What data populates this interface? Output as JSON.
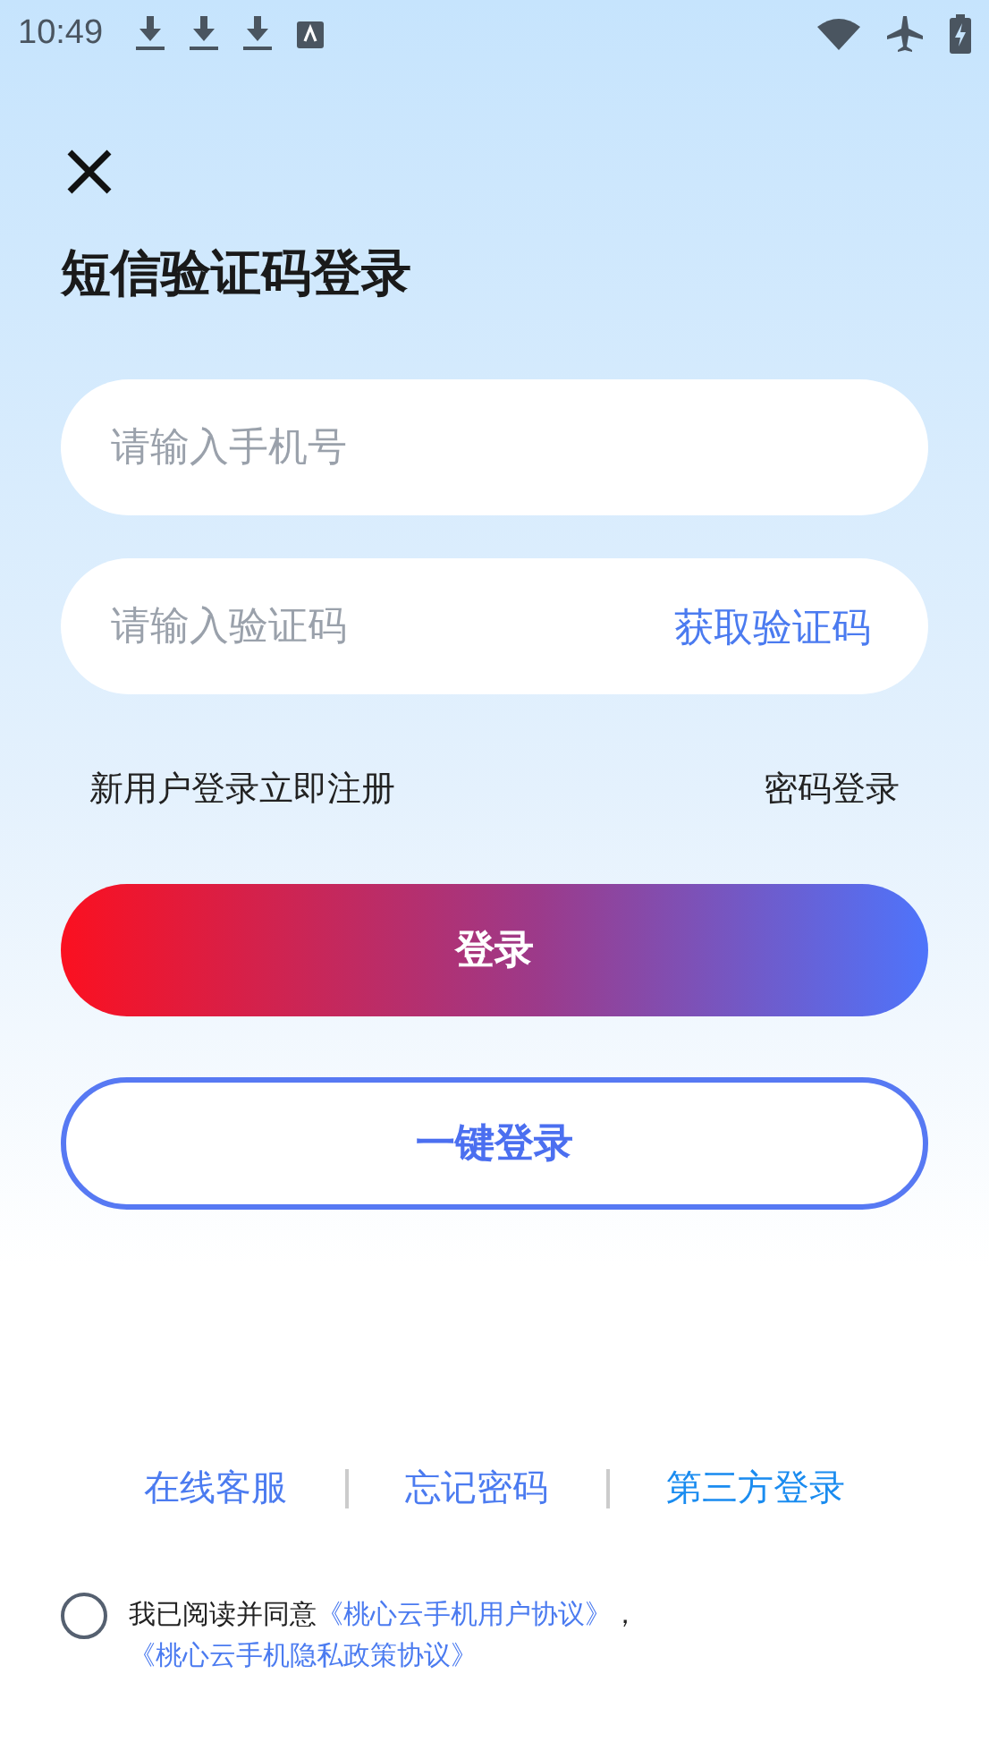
{
  "status_bar": {
    "time": "10:49"
  },
  "title": "短信验证码登录",
  "phone_field": {
    "placeholder": "请输入手机号"
  },
  "code_field": {
    "placeholder": "请输入验证码",
    "action": "获取验证码"
  },
  "links": {
    "register": "新用户登录立即注册",
    "password_login": "密码登录"
  },
  "login_button": "登录",
  "one_click_button": "一键登录",
  "footer_links": [
    {
      "label": "在线客服",
      "color": "#4b7bf0"
    },
    {
      "label": "忘记密码",
      "color": "#4b7bf0"
    },
    {
      "label": "第三方登录",
      "color": "#1a8cf0"
    }
  ],
  "agreement": {
    "checked": false,
    "text": "我已阅读并同意",
    "links": [
      "《桃心云手机用户协议》",
      "《桃心云手机隐私政策协议》"
    ],
    "separator": "，"
  }
}
